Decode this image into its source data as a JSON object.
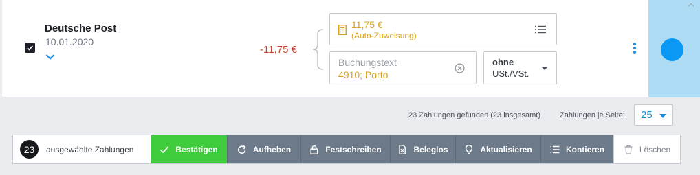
{
  "transaction": {
    "payee": "Deutsche Post",
    "date": "10.01.2020",
    "amount": "-11,75 €",
    "auto_assignment": {
      "amount": "11,75 €",
      "note": "(Auto-Zuweisung)"
    },
    "booking_text": {
      "label": "Buchungstext",
      "value": "4910; Porto"
    },
    "vat": {
      "line1": "ohne",
      "line2": "USt./VSt."
    },
    "checked": true
  },
  "pagination": {
    "found_text": "23 Zahlungen gefunden (23 insgesamt)",
    "per_page_label": "Zahlungen je Seite:",
    "per_page_value": "25"
  },
  "toolbar": {
    "selected_count": "23",
    "selected_label": "ausgewählte Zahlungen",
    "buttons": {
      "confirm": "Bestätigen",
      "cancel": "Aufheben",
      "lock": "Festschreiben",
      "no_receipt": "Beleglos",
      "refresh": "Aktualisieren",
      "account": "Kontieren",
      "delete": "Löschen"
    }
  },
  "colors": {
    "accent": "#0a98f5",
    "confirm": "#3fcc3c",
    "action": "#6c7a8a",
    "amount_negative": "#c2462e",
    "auto_text": "#d9a21b"
  },
  "icons": {
    "checkbox": "check-icon",
    "expand": "chevron-down-icon",
    "document": "document-icon",
    "list": "list-icon",
    "clear": "clear-circle-icon",
    "more": "kebab-menu-icon",
    "confirm": "check-icon",
    "cancel": "undo-icon",
    "lock": "lock-icon",
    "no_receipt": "no-receipt-icon",
    "refresh": "bulb-icon",
    "account": "list-icon",
    "delete": "trash-icon"
  }
}
